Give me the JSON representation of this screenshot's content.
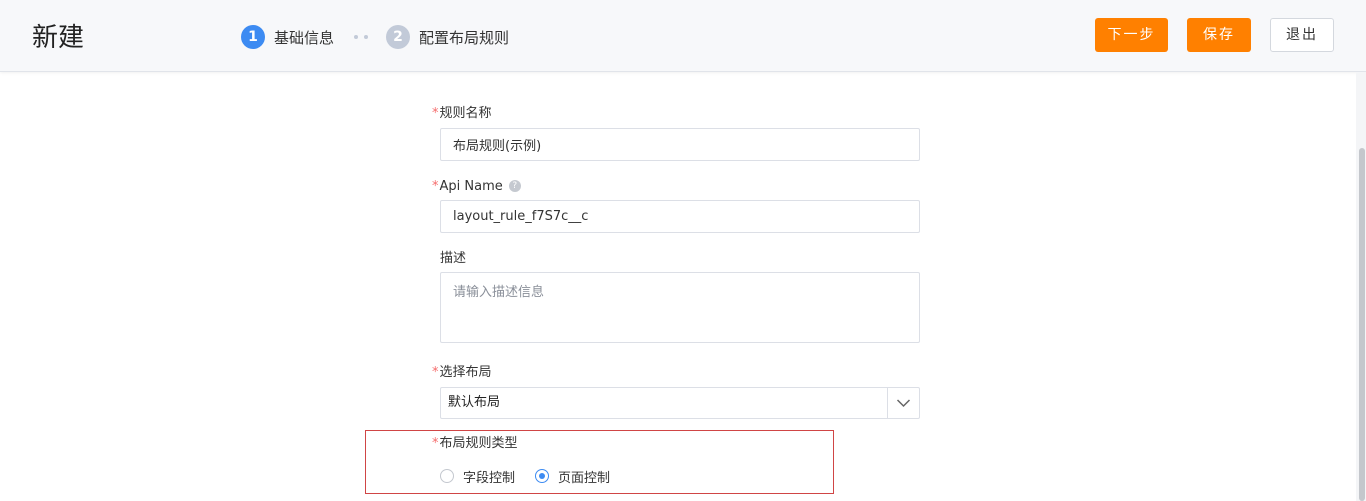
{
  "header": {
    "title": "新建",
    "steps": [
      {
        "number": "1",
        "label": "基础信息"
      },
      {
        "number": "2",
        "label": "配置布局规则"
      }
    ],
    "buttons": {
      "next": "下一步",
      "save": "保存",
      "exit": "退出"
    }
  },
  "form": {
    "rule_name": {
      "required_mark": "*",
      "label": "规则名称",
      "value": "布局规则(示例)"
    },
    "api_name": {
      "required_mark": "*",
      "label": "Api Name",
      "help_icon": "question-icon",
      "value": "layout_rule_f7S7c__c"
    },
    "description": {
      "label": "描述",
      "placeholder": "请输入描述信息"
    },
    "layout": {
      "required_mark": "*",
      "label": "选择布局",
      "value": "默认布局",
      "arrow_icon": "chevron-down-icon"
    },
    "rule_type": {
      "required_mark": "*",
      "label": "布局规则类型",
      "options": [
        {
          "label": "字段控制",
          "checked": false
        },
        {
          "label": "页面控制",
          "checked": true
        }
      ]
    }
  },
  "colors": {
    "primary_button": "#ff8000",
    "active_step": "#3d8bf2",
    "inactive_step": "#c2cad8",
    "required": "#f56c6c",
    "highlight_border": "#d04545"
  }
}
